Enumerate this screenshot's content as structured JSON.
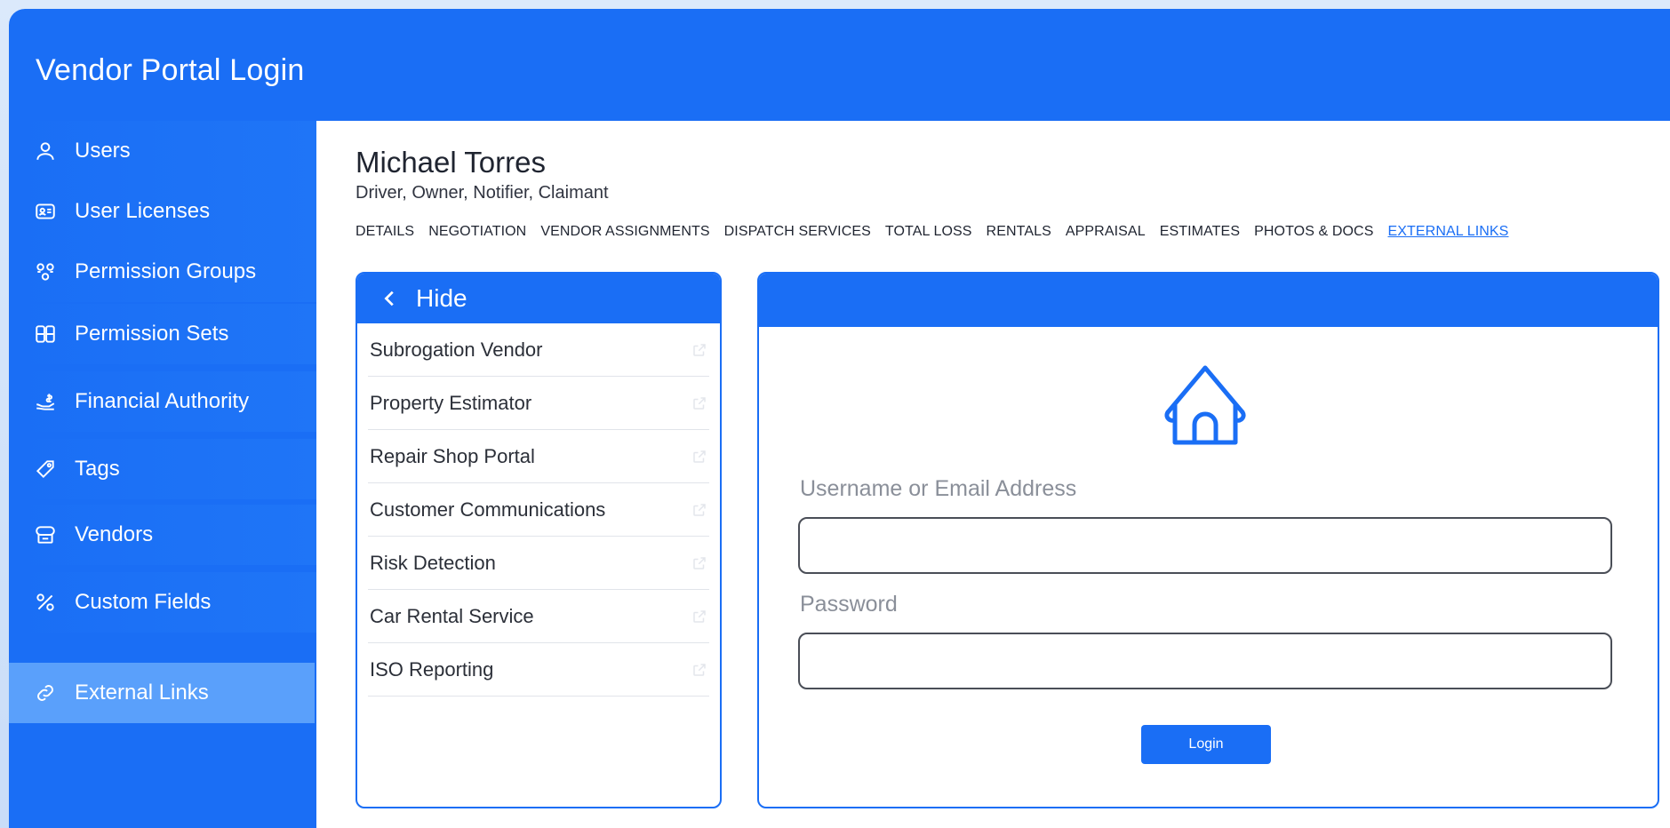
{
  "app": {
    "title": "Vendor Portal Login"
  },
  "sidebar": {
    "items": [
      {
        "label": "Users",
        "icon": "user-icon"
      },
      {
        "label": "User Licenses",
        "icon": "id-card-icon"
      },
      {
        "label": "Permission Groups",
        "icon": "group-icon"
      },
      {
        "label": "Permission Sets",
        "icon": "grid-icon"
      },
      {
        "label": "Financial Authority",
        "icon": "hand-dollar-icon"
      },
      {
        "label": "Tags",
        "icon": "tag-icon"
      },
      {
        "label": "Vendors",
        "icon": "vendor-icon"
      },
      {
        "label": "Custom Fields",
        "icon": "percent-icon"
      },
      {
        "label": "External Links",
        "icon": "link-icon",
        "active": true
      }
    ]
  },
  "person": {
    "name": "Michael Torres",
    "roles": "Driver, Owner, Notifier, Claimant"
  },
  "tabs": [
    "DETAILS",
    "NEGOTIATION",
    "VENDOR ASSIGNMENTS",
    "DISPATCH SERVICES",
    "TOTAL LOSS",
    "RENTALS",
    "APPRAISAL",
    "ESTIMATES",
    "PHOTOS & DOCS",
    "EXTERNAL LINKS"
  ],
  "active_tab": "EXTERNAL LINKS",
  "links_panel": {
    "hide_label": "Hide",
    "links": [
      "Subrogation Vendor",
      "Property Estimator",
      "Repair Shop Portal",
      "Customer Communications",
      "Risk Detection",
      "Car Rental Service",
      "ISO Reporting"
    ]
  },
  "login": {
    "username_label": "Username or Email Address",
    "username_value": "",
    "password_label": "Password",
    "password_value": "",
    "button_label": "Login"
  },
  "colors": {
    "primary": "#1a6ef5",
    "sidebar_active": "#5aa0fb"
  }
}
